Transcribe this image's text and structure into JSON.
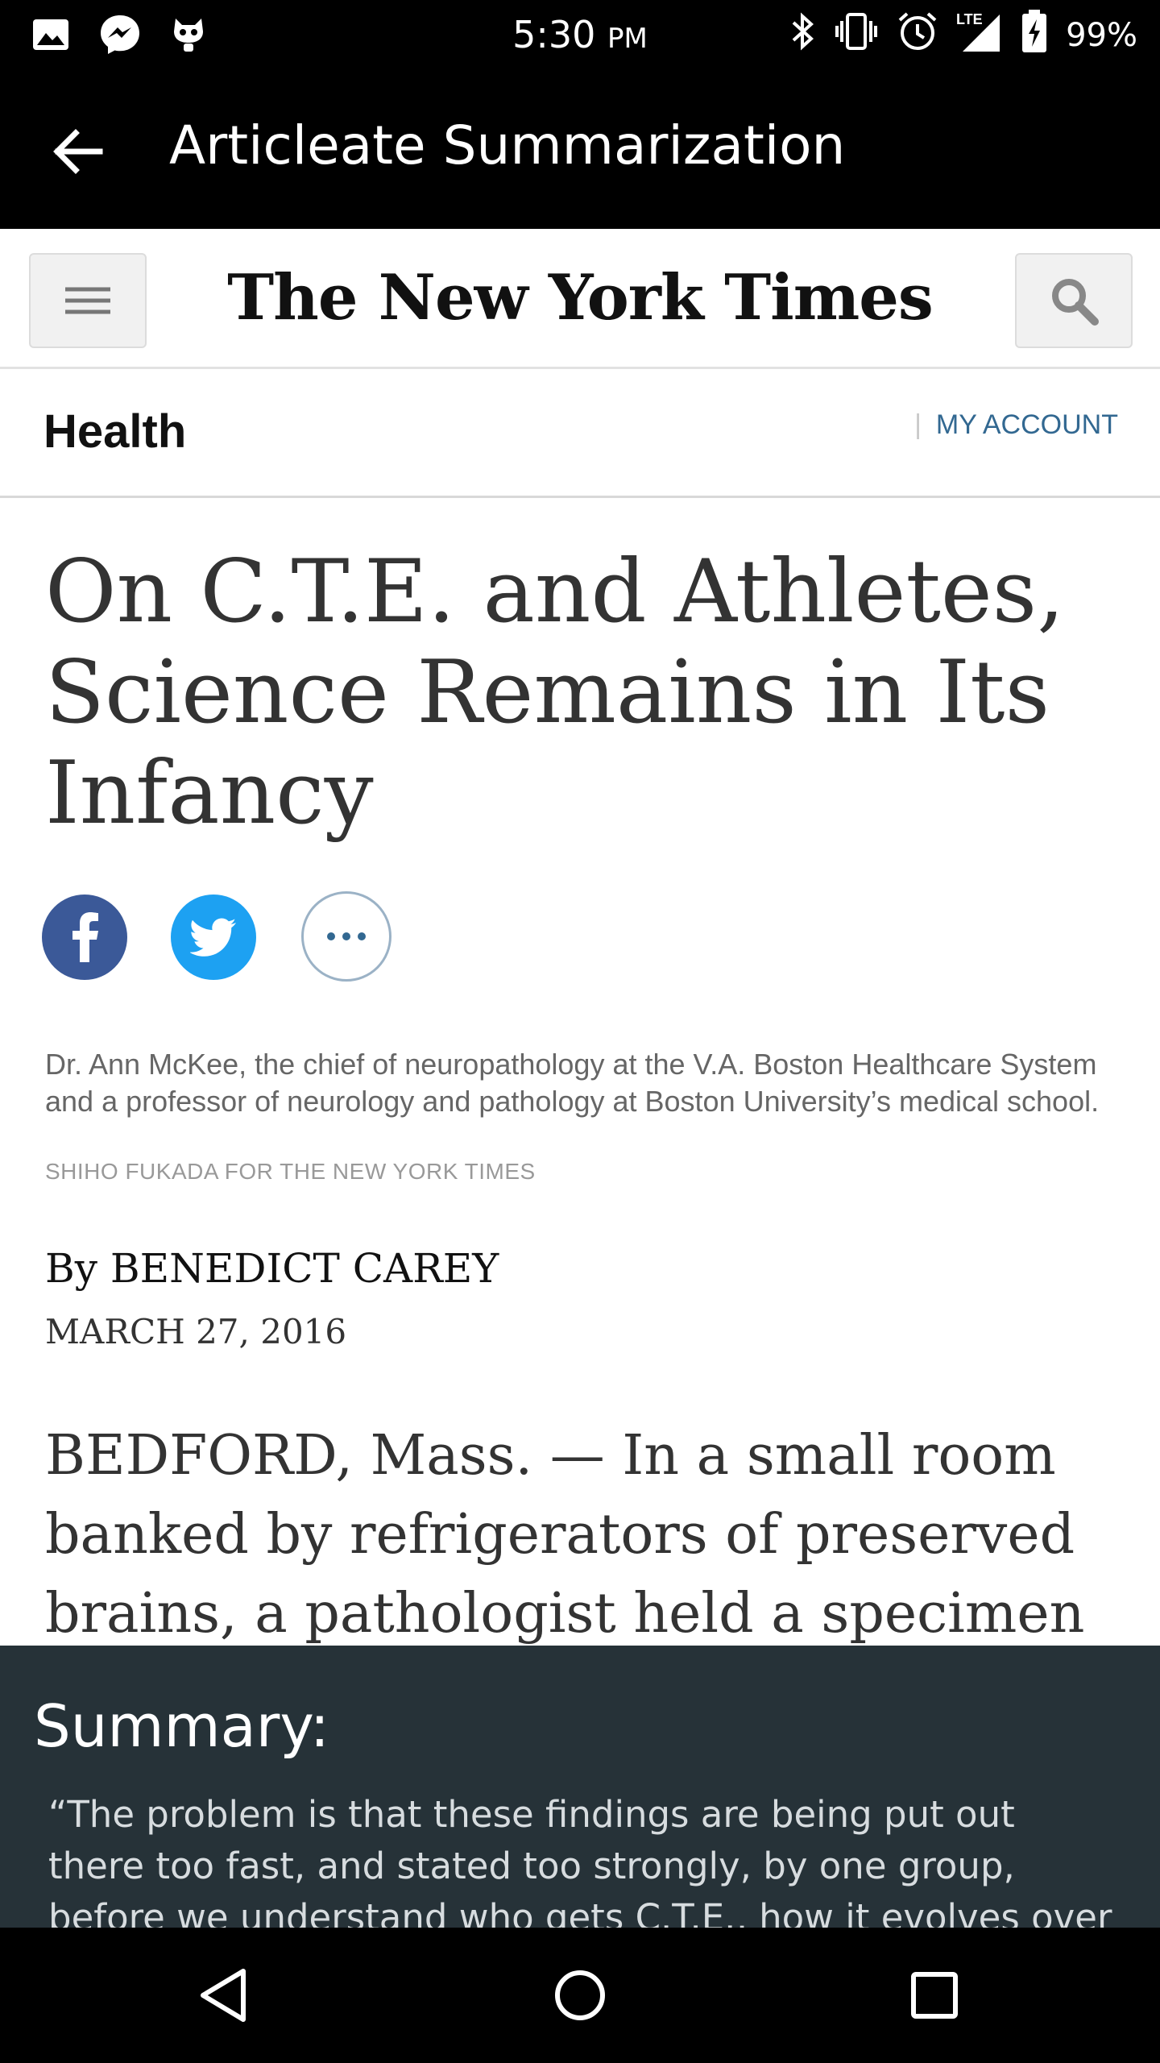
{
  "status_bar": {
    "time": "5:30",
    "ampm": "PM",
    "network": "LTE",
    "battery": "99%"
  },
  "app_bar": {
    "title": "Articleate Summarization"
  },
  "nyt": {
    "logo": "The New York Times",
    "section": "Health",
    "account_label": "MY ACCOUNT"
  },
  "article": {
    "headline": "On C.T.E. and Athletes, Science Remains in Its Infancy",
    "caption": "Dr. Ann McKee, the chief of neuropathology at the V.A. Boston Healthcare System and a professor of neurology and pathology at Boston University’s medical school.",
    "credit": "SHIHO FUKADA FOR THE NEW YORK TIMES",
    "byline": "By BENEDICT CAREY",
    "date": "MARCH 27, 2016",
    "body": "BEDFORD, Mass. — In a small room banked by refrigerators of preserved brains, a pathologist held a specimen"
  },
  "summary": {
    "title": "Summary:",
    "text": "“The problem is that these findings are being put out there too fast, and stated too strongly, by one group, before we understand who gets C.T.E., how it evolves over time, what’s"
  },
  "colors": {
    "facebook": "#3b5998",
    "twitter": "#1da1f2",
    "link": "#326891",
    "summary_bg": "#263238"
  },
  "icons": {
    "menu": "hamburger-icon",
    "search": "search-icon",
    "share_facebook": "facebook-icon",
    "share_twitter": "twitter-icon",
    "share_more": "more-icon"
  }
}
